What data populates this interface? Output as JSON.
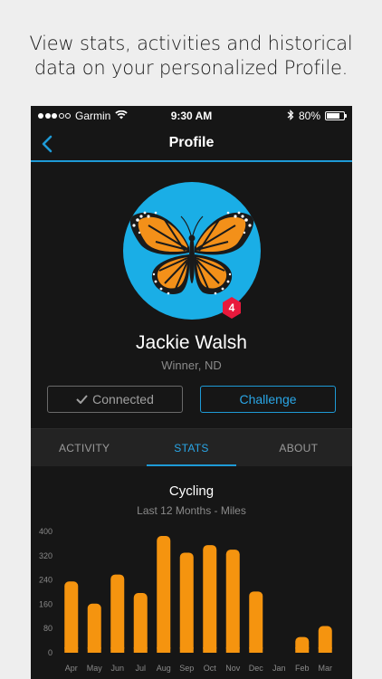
{
  "caption": {
    "line1": "View stats, activities and historical",
    "line2": "data on your personalized Profile."
  },
  "status_bar": {
    "carrier": "Garmin",
    "time": "9:30 AM",
    "battery_text": "80%",
    "battery_level": 0.8,
    "signal_bars": 3
  },
  "nav": {
    "title": "Profile",
    "back_icon": "chevron-left-icon"
  },
  "profile": {
    "name": "Jackie Walsh",
    "location": "Winner, ND",
    "level_badge": "4",
    "avatar_icon": "butterfly-avatar"
  },
  "buttons": {
    "connected_label": "Connected",
    "challenge_label": "Challenge"
  },
  "tabs": [
    {
      "label": "ACTIVITY",
      "active": false
    },
    {
      "label": "STATS",
      "active": true
    },
    {
      "label": "ABOUT",
      "active": false
    }
  ],
  "colors": {
    "accent": "#1e9ad6",
    "bar": "#f5940f",
    "badge": "#e8193c",
    "avatar_bg": "#1aaee6"
  },
  "chart_data": {
    "type": "bar",
    "title": "Cycling",
    "subtitle": "Last 12 Months - Miles",
    "categories": [
      "Apr",
      "May",
      "Jun",
      "Jul",
      "Aug",
      "Sep",
      "Oct",
      "Nov",
      "Dec",
      "Jan",
      "Feb",
      "Mar"
    ],
    "values": [
      235,
      162,
      258,
      197,
      385,
      330,
      355,
      340,
      202,
      0,
      52,
      88
    ],
    "ylim": [
      0,
      400
    ],
    "yticks": [
      "0",
      "80",
      "160",
      "240",
      "320",
      "400"
    ],
    "ytick_values": [
      0,
      80,
      160,
      240,
      320,
      400
    ],
    "grid": false
  }
}
